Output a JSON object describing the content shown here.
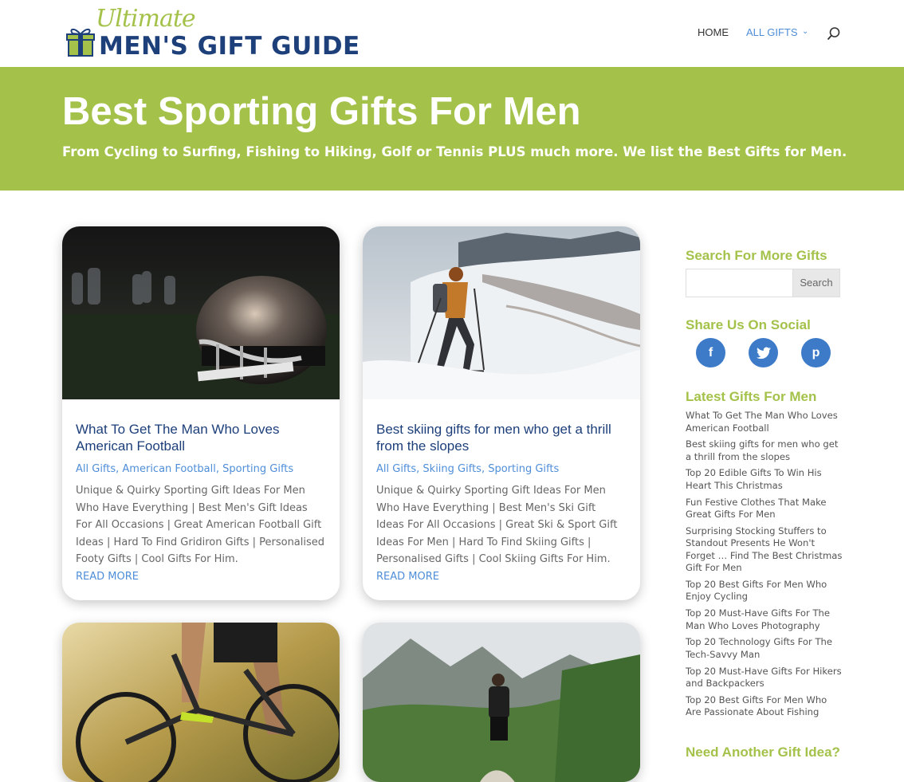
{
  "site": {
    "logo_script": "Ultimate",
    "logo_main": "MEN'S GIFT GUIDE"
  },
  "nav": {
    "home": "HOME",
    "all_gifts": "ALL GIFTS",
    "search_icon": "search-icon"
  },
  "banner": {
    "title": "Best Sporting Gifts For Men",
    "subtitle": "From Cycling to Surfing, Fishing to Hiking, Golf or Tennis PLUS much more. We list the Best Gifts for Men."
  },
  "posts": [
    {
      "title": "What To Get The Man Who Loves American Football",
      "categories": "All Gifts, American Football, Sporting Gifts",
      "excerpt": "Unique & Quirky Sporting Gift Ideas For Men Who Have Everything | Best Men's Gift Ideas For All Occasions | Great American Football Gift Ideas | Hard To Find Gridiron Gifts | Personalised Footy Gifts | Cool Gifts For Him.",
      "read_more": "READ MORE"
    },
    {
      "title": "Best skiing gifts for men who get a thrill from the slopes",
      "categories": "All Gifts, Skiing Gifts, Sporting Gifts",
      "excerpt": "Unique & Quirky Sporting Gift Ideas For Men Who Have Everything | Best Men's Ski Gift Ideas For All Occasions | Great Ski & Sport Gift Ideas For Men | Hard To Find Skiing Gifts | Personalised Gifts | Cool Skiing Gifts For Him.",
      "read_more": "READ MORE"
    }
  ],
  "sidebar": {
    "search_heading": "Search For More Gifts",
    "search_button": "Search",
    "search_placeholder": "",
    "share_heading": "Share Us On Social",
    "social": [
      {
        "label": "f",
        "icon": "facebook-icon"
      },
      {
        "label": "t",
        "icon": "twitter-icon"
      },
      {
        "label": "p",
        "icon": "pinterest-icon"
      }
    ],
    "latest_heading": "Latest Gifts For Men",
    "latest": [
      "What To Get The Man Who Loves American Football",
      "Best skiing gifts for men who get a thrill from the slopes",
      "Top 20 Edible Gifts To Win His Heart This Christmas",
      "Fun Festive Clothes That Make Great Gifts For Men",
      "Surprising Stocking Stuffers to Standout Presents He Won't Forget … Find The Best Christmas Gift For Men",
      "Top 20 Best Gifts For Men Who Enjoy Cycling",
      "Top 20 Must-Have Gifts For The Man Who Loves Photography",
      "Top 20 Technology Gifts For The Tech-Savvy Man",
      "Top 20 Must-Have Gifts For Hikers and Backpackers",
      "Top 20 Best Gifts For Men Who Are Passionate About Fishing"
    ],
    "another_heading": "Need Another Gift Idea?"
  },
  "colors": {
    "green": "#a4c24a",
    "navy": "#1d3f7a",
    "link_blue": "#4f8ed8",
    "social_blue": "#3d7bc9"
  }
}
